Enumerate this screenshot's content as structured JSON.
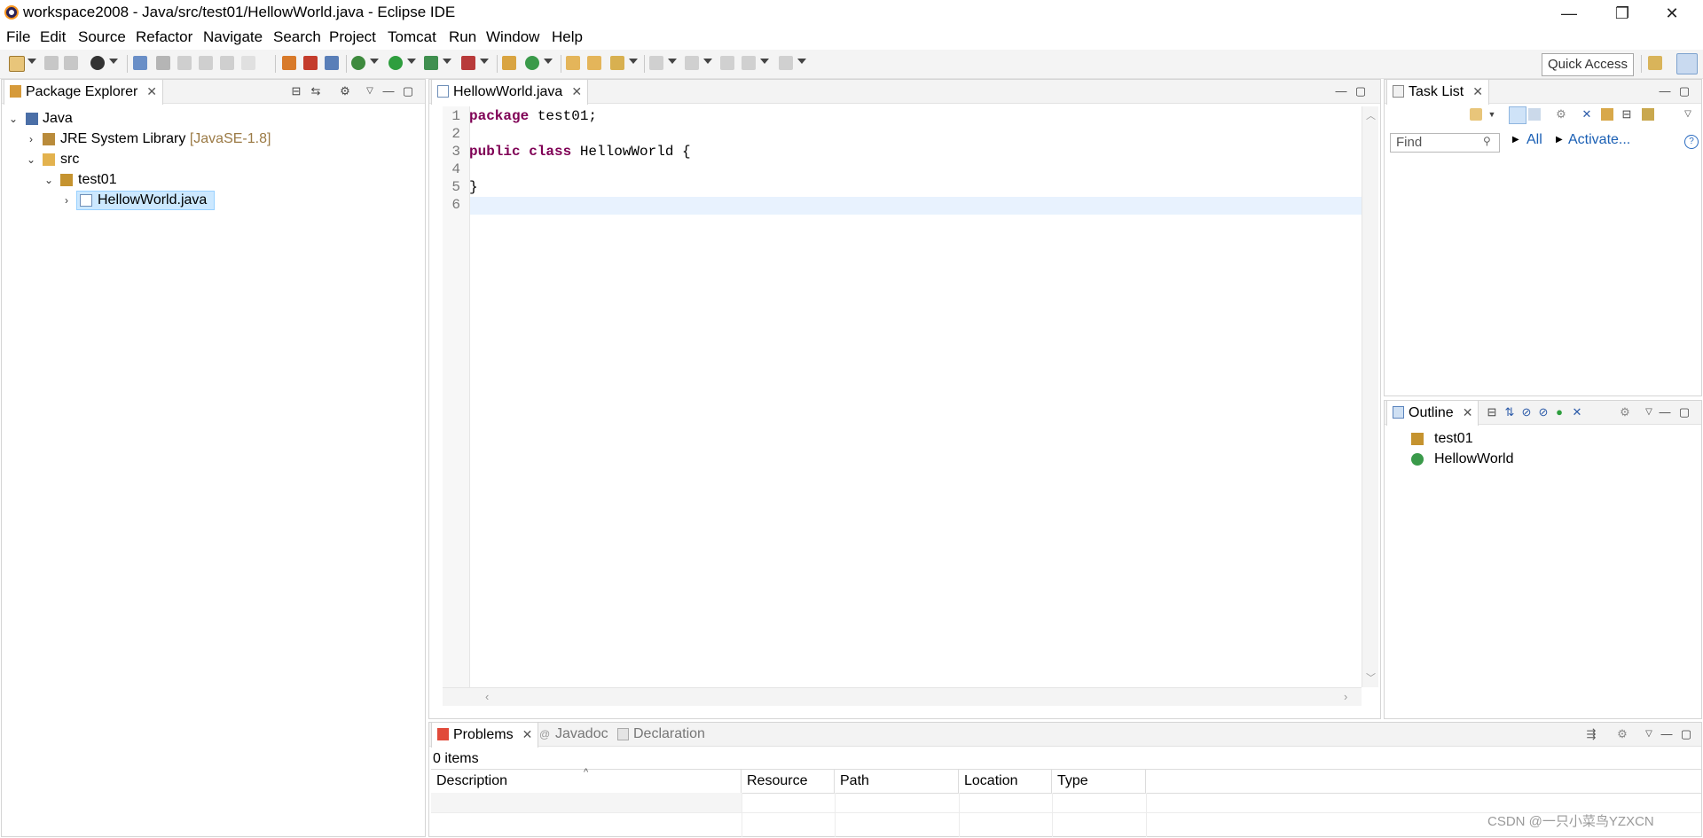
{
  "window": {
    "title": "workspace2008 - Java/src/test01/HellowWorld.java - Eclipse IDE",
    "controls": {
      "minimize": "—",
      "restore": "❐",
      "close": "✕"
    }
  },
  "menu": {
    "items": [
      "File",
      "Edit",
      "Source",
      "Refactor",
      "Navigate",
      "Search",
      "Project",
      "Tomcat",
      "Run",
      "Window",
      "Help"
    ]
  },
  "toolbar": {
    "quick_access": "Quick Access"
  },
  "package_explorer": {
    "tab_label": "Package Explorer",
    "tree": {
      "project": "Java",
      "jre_label": "JRE System Library",
      "jre_version": "[JavaSE-1.8]",
      "src": "src",
      "package": "test01",
      "file": "HellowWorld.java"
    }
  },
  "editor": {
    "tab_label": "HellowWorld.java",
    "lines": [
      {
        "num": "1",
        "kw": "package",
        "rest": " test01;"
      },
      {
        "num": "2",
        "kw": "",
        "rest": ""
      },
      {
        "num": "3",
        "kw": "public class",
        "rest": " HellowWorld {"
      },
      {
        "num": "4",
        "kw": "",
        "rest": ""
      },
      {
        "num": "5",
        "kw": "",
        "rest": "}"
      },
      {
        "num": "6",
        "kw": "",
        "rest": ""
      }
    ]
  },
  "task_list": {
    "tab_label": "Task List",
    "find_placeholder": "Find",
    "all_label": "All",
    "activate_label": "Activate..."
  },
  "outline": {
    "tab_label": "Outline",
    "items": [
      "test01",
      "HellowWorld"
    ]
  },
  "bottom_panel": {
    "tabs": [
      "Problems",
      "Javadoc",
      "Declaration"
    ],
    "status": "0 items",
    "columns": [
      "Description",
      "Resource",
      "Path",
      "Location",
      "Type"
    ]
  },
  "watermark": "CSDN @一只小菜鸟YZXCN",
  "colors": {
    "keyword": "#7f0055",
    "link": "#1a5fb4",
    "selection": "#cce8ff",
    "current_line": "#e8f2fe"
  }
}
